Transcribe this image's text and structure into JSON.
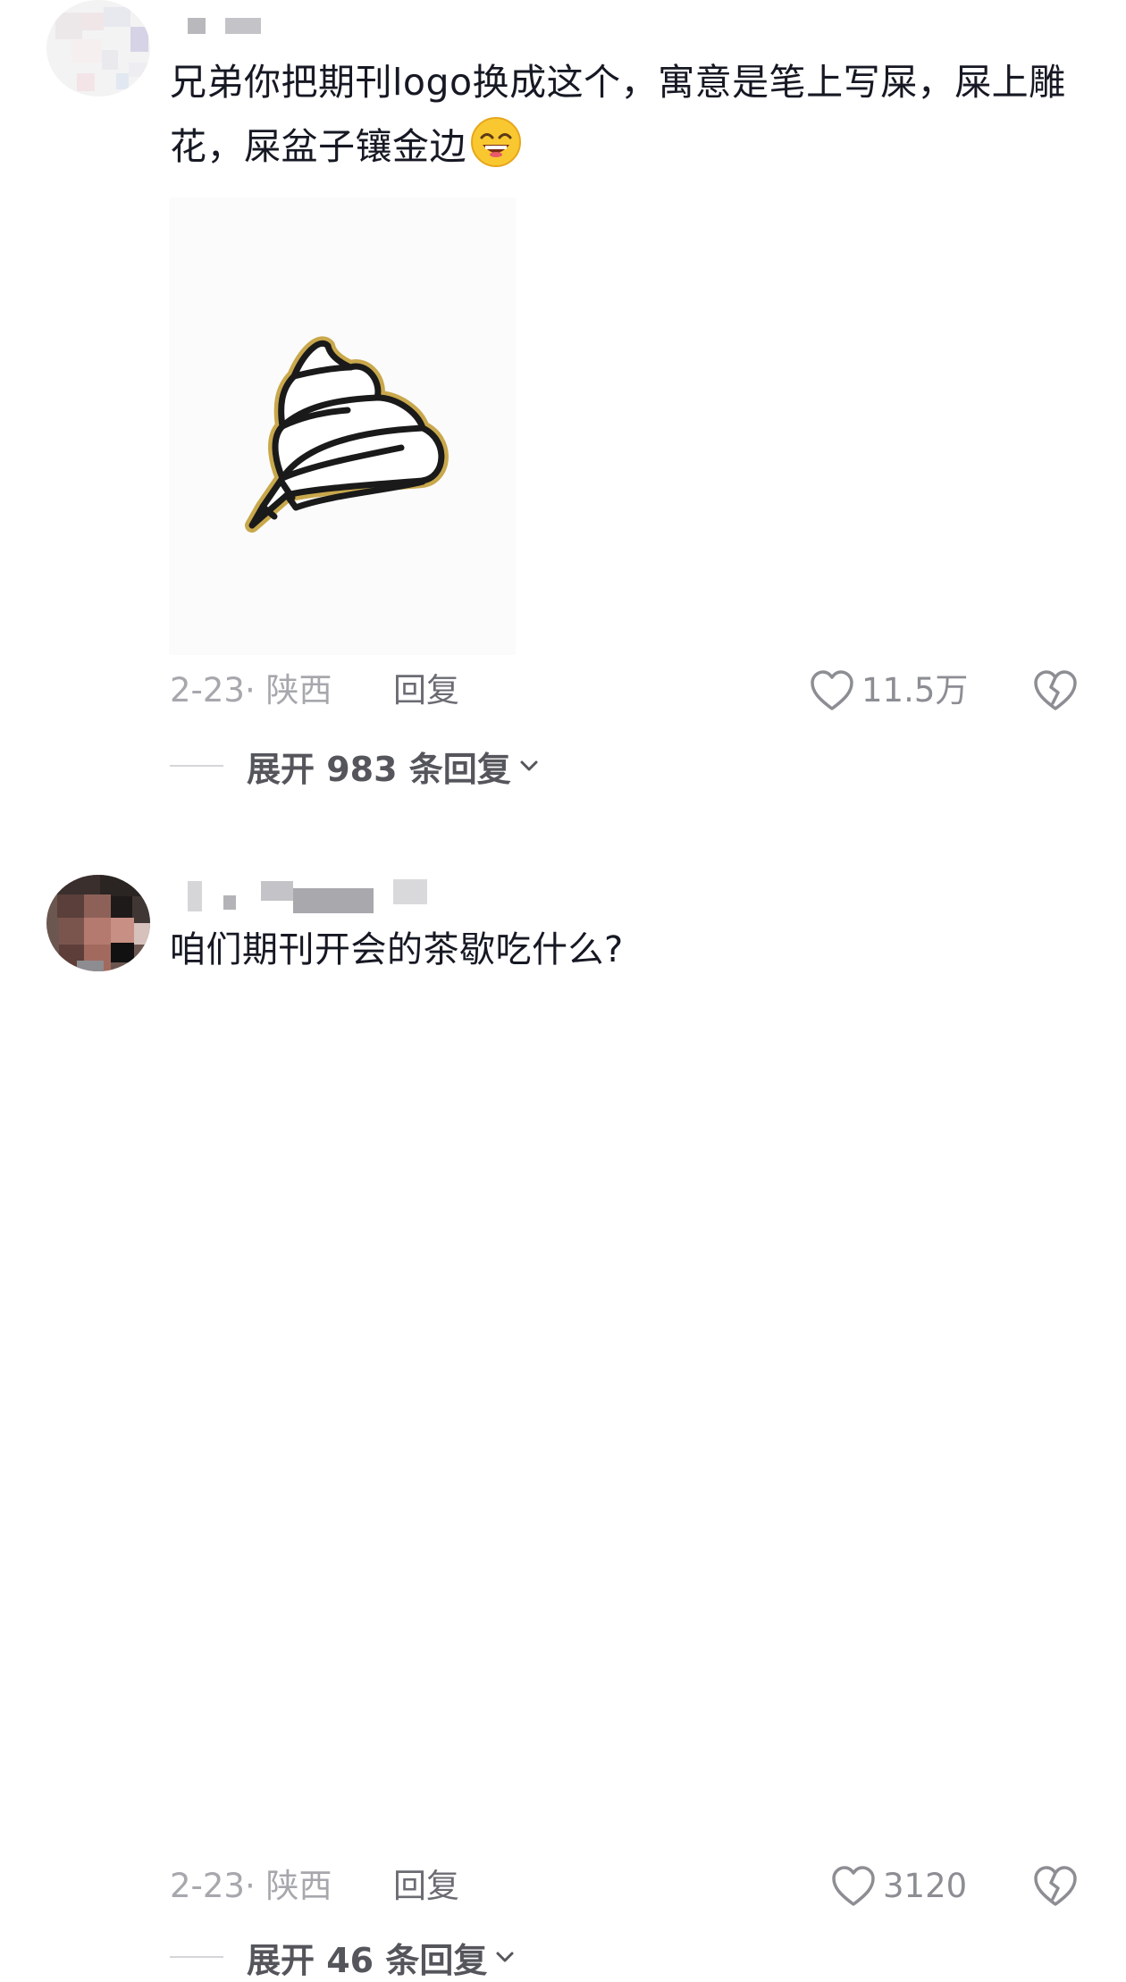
{
  "comments": [
    {
      "text": "兄弟你把期刊logo换成这个，寓意是笔上写屎，屎上雕花，屎盆子镶金边",
      "emoji": "grinning-squint-emoji",
      "attachment": "poop-pen-logo-image",
      "date_location": "2-23· 陕西",
      "reply_label": "回复",
      "likes": "11.5万",
      "expand_label": "展开 983 条回复"
    },
    {
      "text": "咱们期刊开会的茶歇吃什么?",
      "date_location": "2-23· 陕西",
      "reply_label": "回复",
      "likes": "3120",
      "expand_label": "展开 46 条回复"
    }
  ],
  "icons": {
    "like": "heart-outline-icon",
    "dislike": "broken-heart-icon",
    "expand": "chevron-down-icon"
  },
  "colors": {
    "text": "#161823",
    "secondary": "#a7a8ad",
    "gold_outline": "#c9a84c"
  }
}
